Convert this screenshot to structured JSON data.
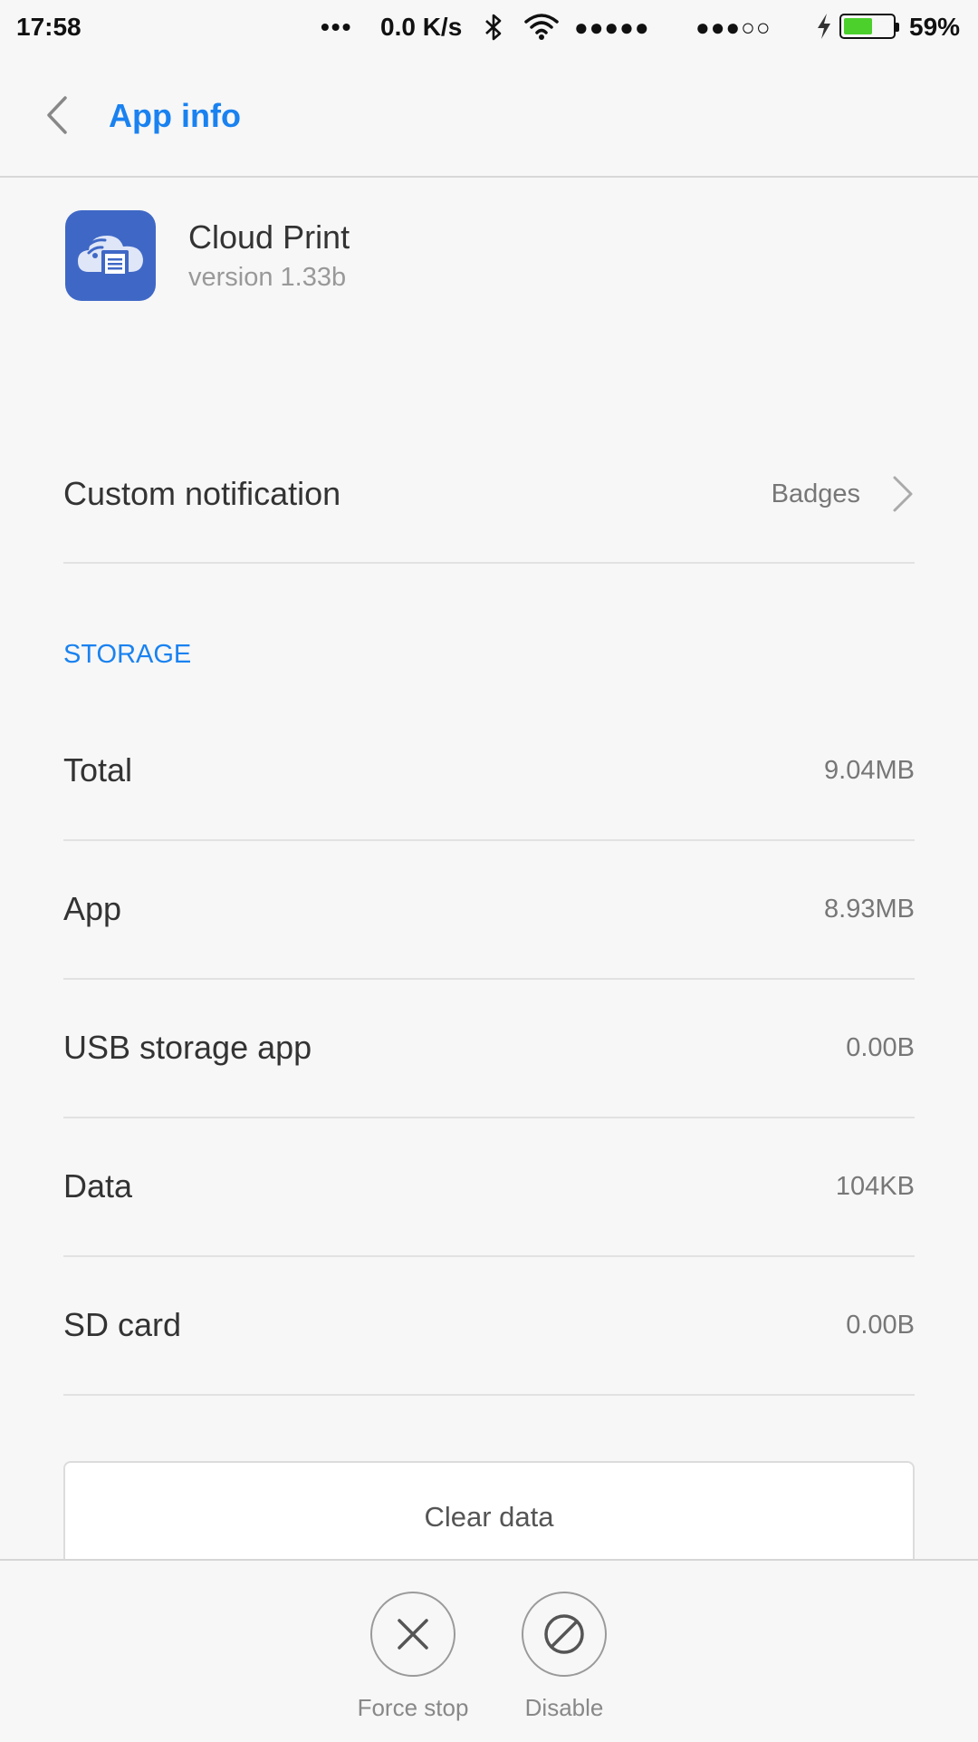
{
  "status_bar": {
    "time": "17:58",
    "more": "•••",
    "net_speed": "0.0 K/s",
    "signal_1": "●●●●●",
    "signal_2": "●●●○○",
    "battery_percent": "59%",
    "battery_level": 0.59
  },
  "header": {
    "title": "App info"
  },
  "app": {
    "name": "Cloud Print",
    "version": "version 1.33b",
    "icon_color": "#3f68c6"
  },
  "notification": {
    "label": "Custom notification",
    "value": "Badges"
  },
  "storage": {
    "section_label": "STORAGE",
    "rows": [
      {
        "label": "Total",
        "value": "9.04MB"
      },
      {
        "label": "App",
        "value": "8.93MB"
      },
      {
        "label": "USB storage app",
        "value": "0.00B"
      },
      {
        "label": "Data",
        "value": "104KB"
      },
      {
        "label": "SD card",
        "value": "0.00B"
      }
    ],
    "clear_label": "Clear data"
  },
  "actions": {
    "force_stop": "Force stop",
    "disable": "Disable"
  },
  "colors": {
    "accent": "#1a82f0",
    "battery": "#4cd02c"
  }
}
